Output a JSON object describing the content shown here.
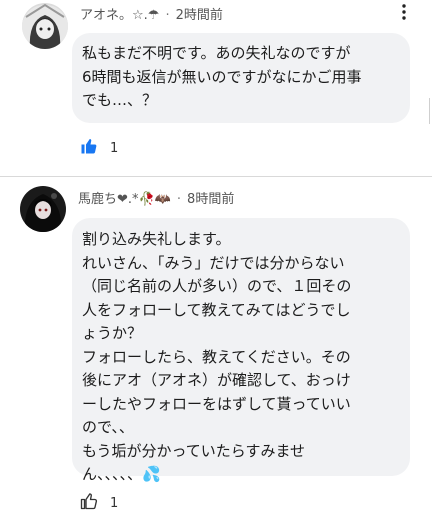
{
  "comments": [
    {
      "username": "アオネ。☆.☂",
      "time": "2時間前",
      "lines": [
        "私もまだ不明です。あの失礼なのですが",
        "6時間も返信が無いのですがなにかご用事",
        "でも…、？"
      ],
      "likes": "1",
      "liked": true
    },
    {
      "username": "馬鹿ち❤.*🥀🦇",
      "time": "8時間前",
      "lines": [
        "割り込み失礼します。",
        "れいさん、「みう」だけでは分からない",
        "（同じ名前の人が多い）ので、１回その",
        "人をフォローして教えてみてはどうでし",
        "ょうか？",
        "フォローしたら、教えてください。その",
        "後にアオ（アオネ）が確認して、おっけ",
        "ーしたやフォローをはずして貰っていい",
        "ので、、",
        "もう垢が分かっていたらすみませ",
        "ん、、、、、💦"
      ],
      "likes": "1",
      "liked": false
    }
  ],
  "colors": {
    "liked_blue": "#1877f2",
    "bubble_bg": "#f1f2f4"
  },
  "icons": [
    "avatar",
    "kebab-menu-icon",
    "thumbs-up-icon",
    "baby-bottle-emoji",
    "wilted-rose-emoji",
    "bat-emoji"
  ]
}
